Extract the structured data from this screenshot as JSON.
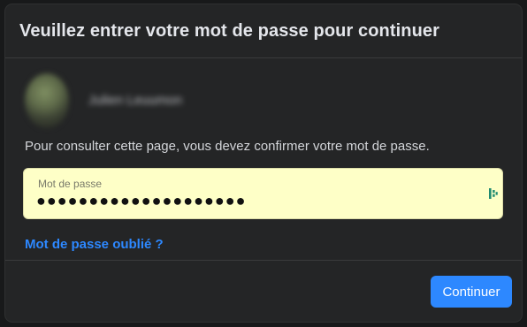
{
  "dialog": {
    "title": "Veuillez entrer votre mot de passe pour continuer"
  },
  "user": {
    "name_blurred": "Julien Leuumon"
  },
  "message": "Pour consulter cette page, vous devez confirmer votre mot de passe.",
  "password_field": {
    "label": "Mot de passe",
    "value_masked": "●●●●●●●●●●●●●●●●●●●●"
  },
  "forgot_link": "Mot de passe oublié ?",
  "continue_button": "Continuer",
  "colors": {
    "dialog_bg": "#242526",
    "accent": "#2d88ff",
    "input_bg": "#feffc7"
  },
  "icons": {
    "avatar": "profile-photo",
    "password_manager": "password-manager-icon"
  }
}
